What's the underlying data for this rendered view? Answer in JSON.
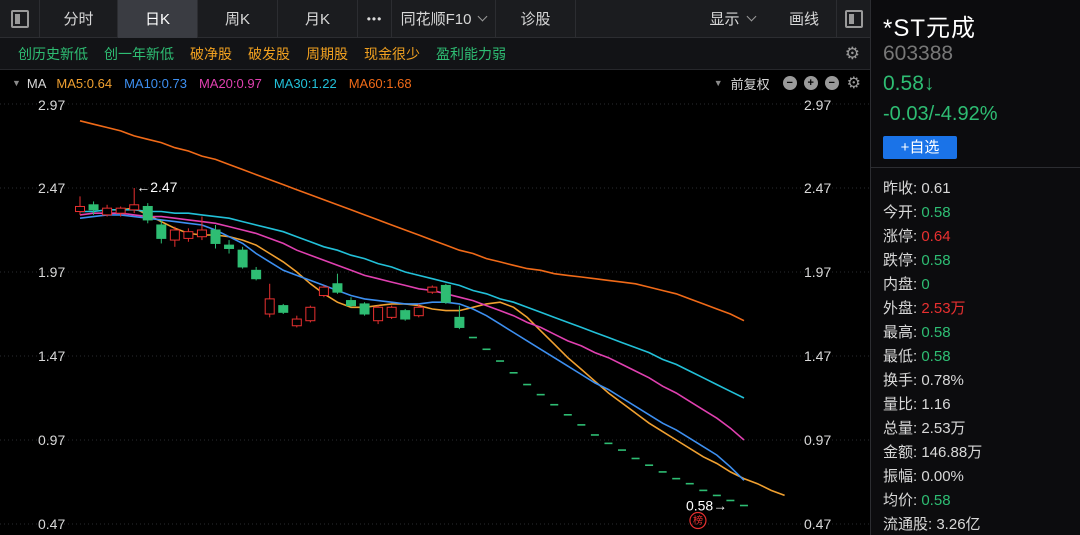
{
  "toolbar": {
    "tabs": [
      {
        "label": "分时",
        "active": false
      },
      {
        "label": "日K",
        "active": true
      },
      {
        "label": "周K",
        "active": false
      },
      {
        "label": "月K",
        "active": false
      }
    ],
    "more_label": "•••",
    "f10_label": "同花顺F10",
    "diagnose_label": "诊股",
    "display_label": "显示",
    "draw_label": "画线"
  },
  "filters": [
    {
      "label": "创历史新低",
      "color": "#2ebd73"
    },
    {
      "label": "创一年新低",
      "color": "#2ebd73"
    },
    {
      "label": "破净股",
      "color": "#f0a020"
    },
    {
      "label": "破发股",
      "color": "#f0a020"
    },
    {
      "label": "周期股",
      "color": "#f0a020"
    },
    {
      "label": "现金很少",
      "color": "#f0a020"
    },
    {
      "label": "盈利能力弱",
      "color": "#2ebd73"
    }
  ],
  "ma_bar": {
    "name": "MA",
    "items": [
      {
        "label": "MA5:0.64",
        "color": "#f0a030"
      },
      {
        "label": "MA10:0.73",
        "color": "#3d8ff0"
      },
      {
        "label": "MA20:0.97",
        "color": "#e040b0"
      },
      {
        "label": "MA30:1.22",
        "color": "#22c0d8"
      },
      {
        "label": "MA60:1.68",
        "color": "#f06a18"
      }
    ],
    "adjust_label": "前复权",
    "btn_minus": "−",
    "btn_plus": "+"
  },
  "stock": {
    "name": "*ST元成",
    "code": "603388",
    "price": "0.58↓",
    "change": "-0.03/-4.92%",
    "add_label": "+自选",
    "up_color": "#e83030",
    "down_color": "#2ebd73",
    "stats": [
      {
        "label": "昨收:",
        "value": "0.61",
        "color": "#d8d8d8"
      },
      {
        "label": "今开:",
        "value": "0.58",
        "color": "#2ebd73"
      },
      {
        "label": "涨停:",
        "value": "0.64",
        "color": "#e83030"
      },
      {
        "label": "跌停:",
        "value": "0.58",
        "color": "#2ebd73"
      },
      {
        "label": "内盘:",
        "value": "0",
        "color": "#2ebd73"
      },
      {
        "label": "外盘:",
        "value": "2.53万",
        "color": "#e83030"
      },
      {
        "label": "最高:",
        "value": "0.58",
        "color": "#2ebd73"
      },
      {
        "label": "最低:",
        "value": "0.58",
        "color": "#2ebd73"
      },
      {
        "label": "换手:",
        "value": "0.78%",
        "color": "#d8d8d8"
      },
      {
        "label": "量比:",
        "value": "1.16",
        "color": "#d8d8d8"
      },
      {
        "label": "总量:",
        "value": "2.53万",
        "color": "#d8d8d8"
      },
      {
        "label": "金额:",
        "value": "146.88万",
        "color": "#d8d8d8"
      },
      {
        "label": "振幅:",
        "value": "0.00%",
        "color": "#d8d8d8"
      },
      {
        "label": "均价:",
        "value": "0.58",
        "color": "#2ebd73"
      },
      {
        "label": "流通股:",
        "value": "3.26亿",
        "color": "#d8d8d8"
      }
    ]
  },
  "chart_data": {
    "type": "candlestick",
    "y_ticks": [
      "2.97",
      "2.47",
      "1.97",
      "1.47",
      "0.97",
      "0.47"
    ],
    "ylim": [
      0.47,
      2.97
    ],
    "grid": true,
    "high_marker": "←2.47",
    "low_marker": "0.58→",
    "badge": "榜",
    "candles": [
      {
        "o": 2.33,
        "c": 2.36,
        "h": 2.42,
        "l": 2.31
      },
      {
        "o": 2.37,
        "c": 2.34,
        "h": 2.39,
        "l": 2.31
      },
      {
        "o": 2.31,
        "c": 2.35,
        "h": 2.37,
        "l": 2.3
      },
      {
        "o": 2.32,
        "c": 2.35,
        "h": 2.36,
        "l": 2.3
      },
      {
        "o": 2.34,
        "c": 2.37,
        "h": 2.47,
        "l": 2.32
      },
      {
        "o": 2.36,
        "c": 2.28,
        "h": 2.38,
        "l": 2.26
      },
      {
        "o": 2.25,
        "c": 2.17,
        "h": 2.28,
        "l": 2.14
      },
      {
        "o": 2.16,
        "c": 2.22,
        "h": 2.24,
        "l": 2.12
      },
      {
        "o": 2.17,
        "c": 2.21,
        "h": 2.23,
        "l": 2.15
      },
      {
        "o": 2.18,
        "c": 2.22,
        "h": 2.3,
        "l": 2.16
      },
      {
        "o": 2.22,
        "c": 2.14,
        "h": 2.25,
        "l": 2.11
      },
      {
        "o": 2.13,
        "c": 2.11,
        "h": 2.16,
        "l": 2.08
      },
      {
        "o": 2.1,
        "c": 2.0,
        "h": 2.12,
        "l": 1.99
      },
      {
        "o": 1.98,
        "c": 1.93,
        "h": 2.0,
        "l": 1.92
      },
      {
        "o": 1.72,
        "c": 1.81,
        "h": 1.9,
        "l": 1.7
      },
      {
        "o": 1.77,
        "c": 1.73,
        "h": 1.78,
        "l": 1.72
      },
      {
        "o": 1.65,
        "c": 1.69,
        "h": 1.71,
        "l": 1.64
      },
      {
        "o": 1.68,
        "c": 1.76,
        "h": 1.77,
        "l": 1.67
      },
      {
        "o": 1.83,
        "c": 1.88,
        "h": 1.89,
        "l": 1.82
      },
      {
        "o": 1.9,
        "c": 1.85,
        "h": 1.96,
        "l": 1.84
      },
      {
        "o": 1.8,
        "c": 1.77,
        "h": 1.82,
        "l": 1.76
      },
      {
        "o": 1.78,
        "c": 1.72,
        "h": 1.79,
        "l": 1.71
      },
      {
        "o": 1.68,
        "c": 1.76,
        "h": 1.77,
        "l": 1.66
      },
      {
        "o": 1.7,
        "c": 1.76,
        "h": 1.77,
        "l": 1.69
      },
      {
        "o": 1.74,
        "c": 1.69,
        "h": 1.75,
        "l": 1.68
      },
      {
        "o": 1.71,
        "c": 1.76,
        "h": 1.78,
        "l": 1.7
      },
      {
        "o": 1.85,
        "c": 1.88,
        "h": 1.89,
        "l": 1.84
      },
      {
        "o": 1.89,
        "c": 1.79,
        "h": 1.9,
        "l": 1.78
      },
      {
        "o": 1.7,
        "c": 1.64,
        "h": 1.77,
        "l": 1.63
      },
      {
        "o": 1.58,
        "c": 1.58,
        "h": 1.58,
        "l": 1.58
      },
      {
        "o": 1.51,
        "c": 1.51,
        "h": 1.51,
        "l": 1.51
      },
      {
        "o": 1.44,
        "c": 1.44,
        "h": 1.44,
        "l": 1.44
      },
      {
        "o": 1.37,
        "c": 1.37,
        "h": 1.37,
        "l": 1.37
      },
      {
        "o": 1.3,
        "c": 1.3,
        "h": 1.3,
        "l": 1.3
      },
      {
        "o": 1.24,
        "c": 1.24,
        "h": 1.24,
        "l": 1.24
      },
      {
        "o": 1.18,
        "c": 1.18,
        "h": 1.18,
        "l": 1.18
      },
      {
        "o": 1.12,
        "c": 1.12,
        "h": 1.12,
        "l": 1.12
      },
      {
        "o": 1.06,
        "c": 1.06,
        "h": 1.06,
        "l": 1.06
      },
      {
        "o": 1.0,
        "c": 1.0,
        "h": 1.0,
        "l": 1.0
      },
      {
        "o": 0.95,
        "c": 0.95,
        "h": 0.95,
        "l": 0.95
      },
      {
        "o": 0.91,
        "c": 0.91,
        "h": 0.91,
        "l": 0.91
      },
      {
        "o": 0.86,
        "c": 0.86,
        "h": 0.86,
        "l": 0.86
      },
      {
        "o": 0.82,
        "c": 0.82,
        "h": 0.82,
        "l": 0.82
      },
      {
        "o": 0.78,
        "c": 0.78,
        "h": 0.78,
        "l": 0.78
      },
      {
        "o": 0.74,
        "c": 0.74,
        "h": 0.74,
        "l": 0.74
      },
      {
        "o": 0.71,
        "c": 0.71,
        "h": 0.71,
        "l": 0.71
      },
      {
        "o": 0.67,
        "c": 0.67,
        "h": 0.67,
        "l": 0.67
      },
      {
        "o": 0.64,
        "c": 0.64,
        "h": 0.64,
        "l": 0.64
      },
      {
        "o": 0.61,
        "c": 0.61,
        "h": 0.61,
        "l": 0.61
      },
      {
        "o": 0.58,
        "c": 0.58,
        "h": 0.58,
        "l": 0.58
      }
    ],
    "series": [
      {
        "name": "MA5",
        "color": "#f0a030",
        "start": 3,
        "values": [
          2.34,
          2.35,
          2.31,
          2.27,
          2.23,
          2.2,
          2.19,
          2.19,
          2.18,
          2.16,
          2.13,
          2.08,
          2.03,
          1.97,
          1.9,
          1.84,
          1.79,
          1.76,
          1.76,
          1.77,
          1.78,
          1.78,
          1.77,
          1.75,
          1.74,
          1.74,
          1.76,
          1.78,
          1.79,
          1.76,
          1.7,
          1.62,
          1.54,
          1.46,
          1.39,
          1.32,
          1.25,
          1.19,
          1.13,
          1.07,
          1.02,
          0.97,
          0.92,
          0.87,
          0.83,
          0.78,
          0.74,
          0.71,
          0.67,
          0.64
        ]
      },
      {
        "name": "MA10",
        "color": "#3d8ff0",
        "start": 0,
        "values": [
          2.29,
          2.3,
          2.31,
          2.31,
          2.3,
          2.29,
          2.28,
          2.27,
          2.26,
          2.25,
          2.22,
          2.18,
          2.14,
          2.08,
          2.03,
          1.98,
          1.95,
          1.92,
          1.89,
          1.86,
          1.83,
          1.81,
          1.8,
          1.79,
          1.78,
          1.78,
          1.79,
          1.79,
          1.78,
          1.75,
          1.71,
          1.66,
          1.61,
          1.56,
          1.51,
          1.46,
          1.41,
          1.36,
          1.31,
          1.27,
          1.22,
          1.17,
          1.12,
          1.07,
          1.03,
          0.98,
          0.93,
          0.88,
          0.81,
          0.73
        ]
      },
      {
        "name": "MA20",
        "color": "#e040b0",
        "start": 0,
        "values": [
          2.31,
          2.32,
          2.32,
          2.32,
          2.31,
          2.3,
          2.3,
          2.29,
          2.28,
          2.27,
          2.26,
          2.24,
          2.22,
          2.2,
          2.17,
          2.14,
          2.1,
          2.07,
          2.04,
          2.01,
          1.98,
          1.95,
          1.93,
          1.91,
          1.89,
          1.87,
          1.86,
          1.84,
          1.82,
          1.8,
          1.77,
          1.74,
          1.71,
          1.67,
          1.64,
          1.6,
          1.56,
          1.53,
          1.49,
          1.46,
          1.42,
          1.38,
          1.34,
          1.29,
          1.25,
          1.2,
          1.15,
          1.1,
          1.04,
          0.97
        ]
      },
      {
        "name": "MA30",
        "color": "#22c0d8",
        "start": 0,
        "values": [
          2.33,
          2.33,
          2.34,
          2.34,
          2.34,
          2.33,
          2.33,
          2.32,
          2.32,
          2.31,
          2.3,
          2.29,
          2.27,
          2.25,
          2.23,
          2.21,
          2.18,
          2.15,
          2.12,
          2.1,
          2.07,
          2.05,
          2.02,
          2.0,
          1.97,
          1.95,
          1.93,
          1.91,
          1.89,
          1.86,
          1.84,
          1.81,
          1.79,
          1.76,
          1.73,
          1.7,
          1.67,
          1.64,
          1.61,
          1.58,
          1.55,
          1.52,
          1.49,
          1.45,
          1.42,
          1.38,
          1.34,
          1.3,
          1.26,
          1.22
        ]
      },
      {
        "name": "MA60",
        "color": "#f06a18",
        "start": 0,
        "values": [
          2.87,
          2.85,
          2.83,
          2.81,
          2.78,
          2.76,
          2.74,
          2.71,
          2.69,
          2.66,
          2.64,
          2.61,
          2.58,
          2.55,
          2.52,
          2.49,
          2.46,
          2.43,
          2.4,
          2.37,
          2.34,
          2.31,
          2.28,
          2.25,
          2.22,
          2.19,
          2.16,
          2.13,
          2.1,
          2.08,
          2.05,
          2.03,
          2.01,
          1.99,
          1.98,
          1.96,
          1.95,
          1.94,
          1.93,
          1.92,
          1.91,
          1.9,
          1.88,
          1.86,
          1.84,
          1.81,
          1.78,
          1.75,
          1.72,
          1.68
        ]
      }
    ]
  }
}
